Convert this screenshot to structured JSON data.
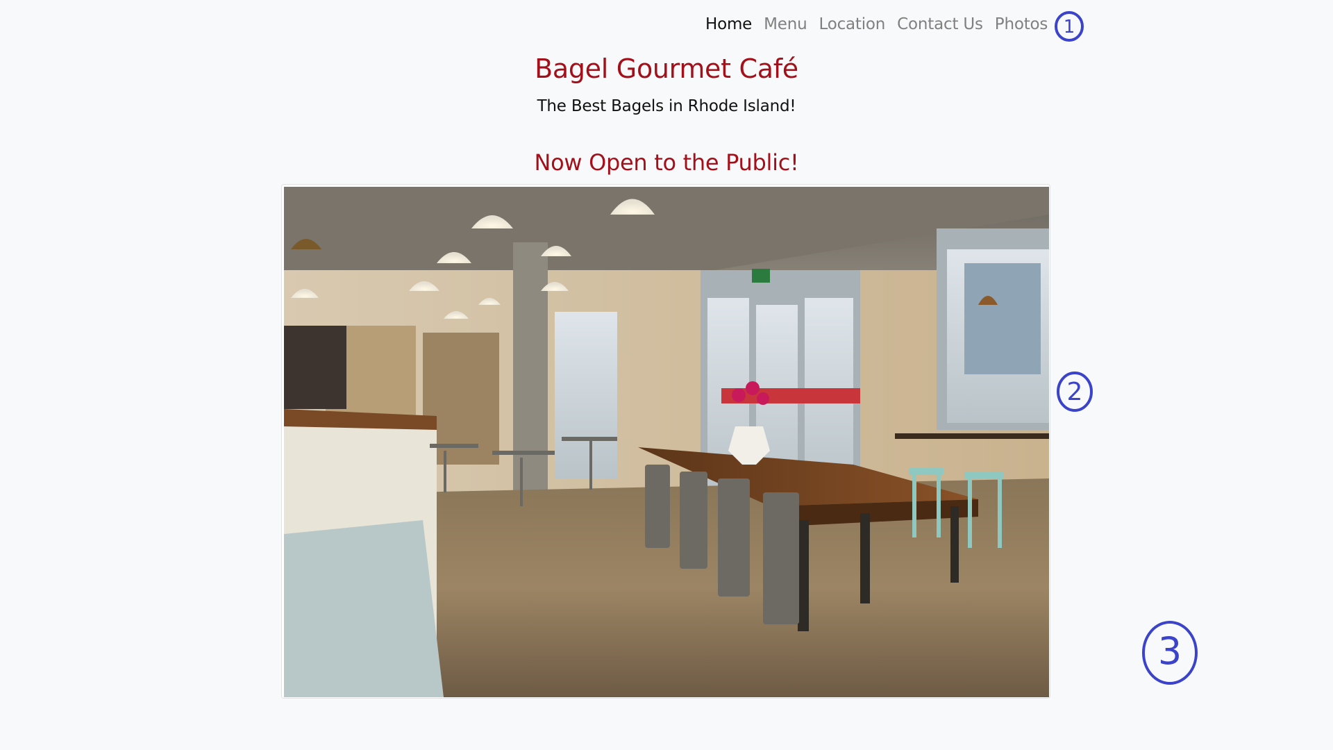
{
  "nav": {
    "items": [
      {
        "label": "Home",
        "active": true
      },
      {
        "label": "Menu",
        "active": false
      },
      {
        "label": "Location",
        "active": false
      },
      {
        "label": "Contact Us",
        "active": false
      },
      {
        "label": "Photos",
        "active": false
      }
    ]
  },
  "header": {
    "title": "Bagel Gourmet Café",
    "tagline": "The Best Bagels in Rhode Island!"
  },
  "main": {
    "announcement": "Now Open to the Public!",
    "photo_icon": "cafe-interior-photo"
  },
  "annotations": {
    "marker_1": "1",
    "marker_2": "2",
    "marker_3": "3"
  },
  "colors": {
    "brand": "#a3101a",
    "nav_inactive": "#808080",
    "nav_active": "#111111",
    "annotation": "#3a43c9",
    "background": "#f8f9fa"
  }
}
